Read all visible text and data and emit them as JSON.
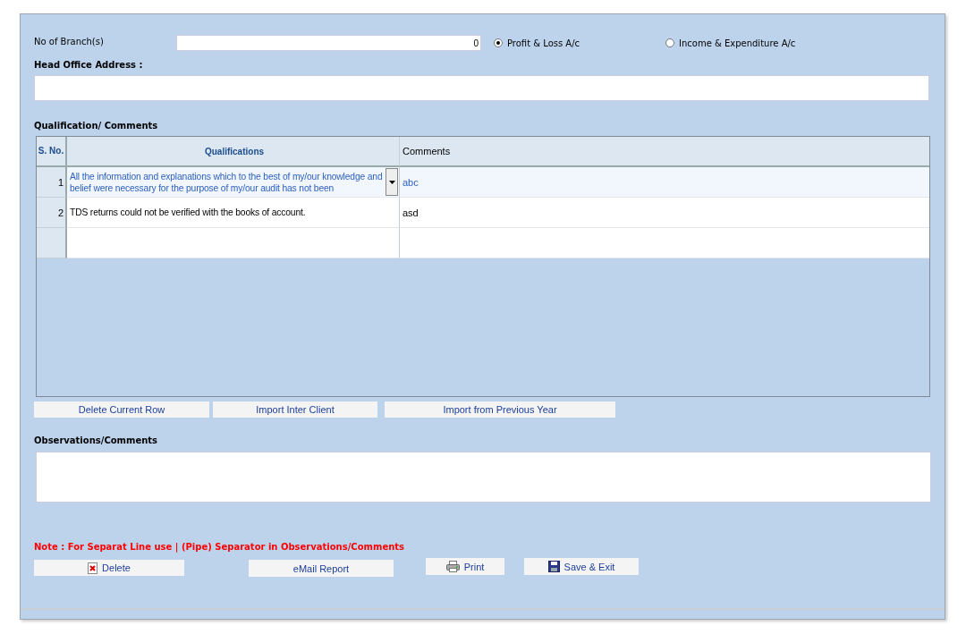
{
  "branches": {
    "label": "No of Branch(s)",
    "value": "0"
  },
  "account_type": [
    {
      "label": "Profit & Loss A/c",
      "selected": true
    },
    {
      "label": "Income & Expenditure A/c",
      "selected": false
    }
  ],
  "head_office": {
    "label": "Head Office Address :"
  },
  "qualifications": {
    "title": "Qualification/ Comments",
    "columns": [
      "S. No.",
      "Qualifications",
      "Comments"
    ],
    "rows": [
      {
        "sno": "1",
        "qualification": "All the information and explanations which to the best of my/our knowledge and belief were necessary for the purpose of my/our audit has not been",
        "comment": "abc",
        "selected": true
      },
      {
        "sno": "2",
        "qualification": "TDS returns could not be verified with the books of account.",
        "comment": "asd",
        "selected": false
      }
    ],
    "buttons": [
      "Delete Current Row",
      "Import Inter Client",
      "Import from Previous Year"
    ]
  },
  "observations": {
    "label": "Observations/Comments"
  },
  "note": "Note : For Separat Line use | (Pipe) Separator in Observations/Comments",
  "actions": [
    {
      "kind": "delete",
      "label": "Delete"
    },
    {
      "kind": "email",
      "label": "eMail Report"
    },
    {
      "kind": "print",
      "label": "Print"
    },
    {
      "kind": "save",
      "label": "Save & Exit"
    }
  ]
}
